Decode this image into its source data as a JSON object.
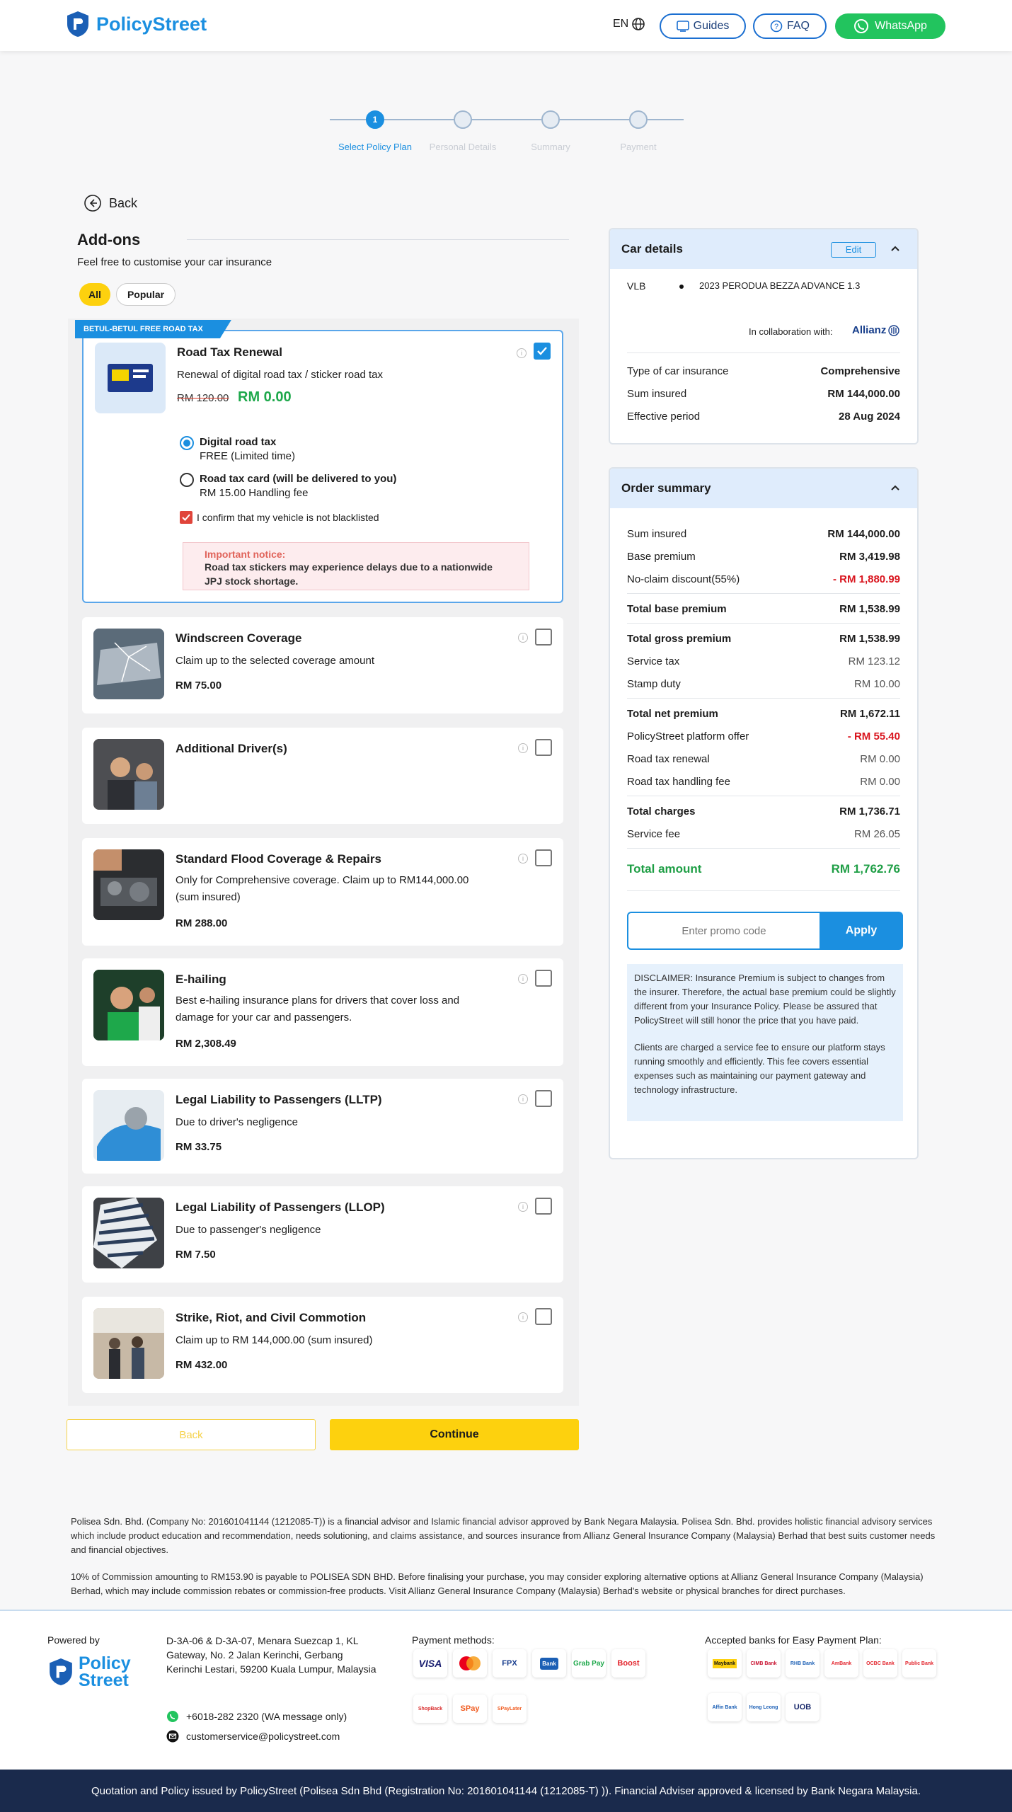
{
  "header": {
    "brand": "PolicyStreet",
    "lang": "EN",
    "guides": "Guides",
    "faq": "FAQ",
    "whatsapp": "WhatsApp"
  },
  "steps": [
    {
      "label": "Select Policy Plan",
      "num": "1"
    },
    {
      "label": "Personal Details"
    },
    {
      "label": "Summary"
    },
    {
      "label": "Payment"
    }
  ],
  "nav": {
    "back": "Back"
  },
  "addons": {
    "title": "Add-ons",
    "subtitle": "Feel free to customise your car insurance",
    "filters": [
      "All",
      "Popular"
    ]
  },
  "road_tax": {
    "ribbon": "BETUL-BETUL FREE ROAD TAX",
    "title": "Road Tax Renewal",
    "desc": "Renewal of digital road tax / sticker road tax",
    "old_price": "RM 120.00",
    "price": "RM 0.00",
    "opt1_title": "Digital road tax",
    "opt1_sub": "FREE (Limited time)",
    "opt2_title": "Road tax card (will be delivered to you)",
    "opt2_sub": "RM 15.00 Handling fee",
    "confirm": "I confirm that my vehicle is not blacklisted",
    "notice_title": "Important notice:",
    "notice_body": "Road tax stickers may experience delays due to a nationwide JPJ stock shortage."
  },
  "cards": [
    {
      "title": "Windscreen Coverage",
      "desc": "Claim up to the selected coverage amount",
      "price": "RM 75.00"
    },
    {
      "title": "Additional Driver(s)",
      "desc": "",
      "price": ""
    },
    {
      "title": "Standard Flood Coverage & Repairs",
      "desc": "Only for Comprehensive coverage. Claim up to RM144,000.00 (sum insured)",
      "price": "RM 288.00"
    },
    {
      "title": "E-hailing",
      "desc": "Best e-hailing insurance plans for drivers that cover loss and damage for your car and passengers.",
      "price": "RM 2,308.49"
    },
    {
      "title": "Legal Liability to Passengers (LLTP)",
      "desc": "Due to driver's negligence",
      "price": "RM 33.75"
    },
    {
      "title": "Legal Liability of Passengers (LLOP)",
      "desc": "Due to passenger's negligence",
      "price": "RM 7.50"
    },
    {
      "title": "Strike, Riot, and Civil Commotion",
      "desc": "Claim up to RM 144,000.00 (sum insured)",
      "price": "RM 432.00"
    }
  ],
  "actions": {
    "back": "Back",
    "continue": "Continue"
  },
  "car": {
    "title": "Car details",
    "edit": "Edit",
    "plate": "VLB",
    "model": "2023 PERODUA BEZZA ADVANCE 1.3",
    "collab": "In collaboration with:",
    "partner": "Allianz",
    "rows": [
      {
        "k": "Type of car insurance",
        "v": "Comprehensive"
      },
      {
        "k": "Sum insured",
        "v": "RM 144,000.00"
      },
      {
        "k": "Effective period",
        "v": "28 Aug 2024"
      }
    ]
  },
  "order": {
    "title": "Order summary",
    "rows": [
      {
        "k": "Sum insured",
        "v": "RM 144,000.00"
      },
      {
        "k": "Base premium",
        "v": "RM 3,419.98"
      },
      {
        "k": "No-claim discount(55%)",
        "v": "- RM 1,880.99"
      },
      {
        "k": "Total base premium",
        "v": "RM 1,538.99"
      },
      {
        "k": "Total gross premium",
        "v": "RM 1,538.99"
      },
      {
        "k": "Service tax",
        "v": "RM 123.12"
      },
      {
        "k": "Stamp duty",
        "v": "RM 10.00"
      },
      {
        "k": "Total net premium",
        "v": "RM 1,672.11"
      },
      {
        "k": "PolicyStreet platform offer",
        "v": "- RM 55.40"
      },
      {
        "k": "Road tax renewal",
        "v": "RM 0.00"
      },
      {
        "k": "Road tax handling fee",
        "v": "RM 0.00"
      },
      {
        "k": "Total charges",
        "v": "RM 1,736.71"
      },
      {
        "k": "Service fee",
        "v": "RM 26.05"
      }
    ],
    "total_label": "Total amount",
    "total_value": "RM 1,762.76",
    "promo_placeholder": "Enter promo code",
    "apply": "Apply",
    "disclaimer1": "DISCLAIMER: Insurance Premium is subject to changes from the insurer. Therefore, the actual base premium could be slightly different from your Insurance Policy. Please be assured that PolicyStreet will still honor the price that you have paid.",
    "disclaimer2": "Clients are charged a service fee to ensure our platform stays running smoothly and efficiently. This fee covers essential expenses such as maintaining our payment gateway and technology infrastructure."
  },
  "legal": {
    "p1": "Polisea Sdn. Bhd. (Company No: 201601041144 (1212085-T)) is a financial advisor and Islamic financial advisor approved by Bank Negara Malaysia. Polisea Sdn. Bhd. provides holistic financial advisory services which include product education and recommendation, needs solutioning, and claims assistance, and sources insurance from Allianz General Insurance Company (Malaysia) Berhad that best suits customer needs and financial objectives.",
    "p2": "10% of Commission amounting to RM153.90 is payable to POLISEA SDN BHD. Before finalising your purchase, you may consider exploring alternative options at Allianz General Insurance Company (Malaysia) Berhad, which may include commission rebates or commission-free products. Visit Allianz General Insurance Company (Malaysia) Berhad's website or physical branches for direct purchases."
  },
  "footer": {
    "powered": "Powered by",
    "brand1": "Policy",
    "brand2": "Street",
    "address": "D-3A-06 & D-3A-07, Menara Suezcap 1, KL Gateway, No. 2 Jalan Kerinchi, Gerbang Kerinchi Lestari, 59200 Kuala Lumpur, Malaysia",
    "phone": "+6018-282 2320 (WA message only)",
    "email": "customerservice@policystreet.com",
    "payment_title": "Payment methods:",
    "payments": [
      "VISA",
      "MC",
      "FPX",
      "Bank",
      "Grab Pay",
      "Boost",
      "ShopBack",
      "SPay",
      "SPayLater"
    ],
    "banks_title": "Accepted banks for Easy Payment Plan:",
    "banks": [
      "Maybank",
      "CIMB Bank",
      "RHB Bank",
      "AmBank",
      "OCBC Bank",
      "Public Bank",
      "Affin Bank",
      "Hong Leong",
      "UOB"
    ],
    "bar": "Quotation and Policy issued by PolicyStreet (Polisea Sdn Bhd (Registration No: 201601041144 (1212085-T) )). Financial Adviser approved & licensed by Bank Negara Malaysia."
  }
}
